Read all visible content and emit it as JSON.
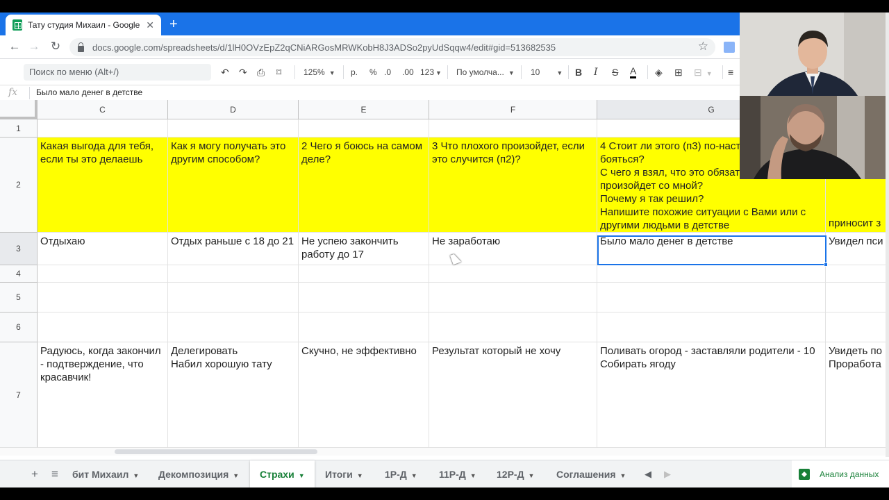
{
  "browser": {
    "tab_title": "Тату студия Михаил - Google Таблицы",
    "url": "docs.google.com/spreadsheets/d/1lH0OVzEpZ2qCNiARGosMRWKobH8J3ADSo2pyUdSqqw4/edit#gid=513682535"
  },
  "toolbar": {
    "menu_search": "Поиск по меню (Alt+/)",
    "zoom": "125%",
    "currency": "р.",
    "percent": "%",
    "dec_decrease": ".0",
    "dec_increase": ".00",
    "format_more": "123",
    "font": "По умолча...",
    "font_size": "10",
    "bold": "B",
    "italic": "I",
    "strike": "S",
    "text_color": "A"
  },
  "formula_bar": {
    "fx": "fx",
    "value": "Было мало денег в детстве"
  },
  "columns": [
    "C",
    "D",
    "E",
    "F",
    "G"
  ],
  "rows": {
    "r1": "1",
    "r2": "2",
    "r3": "3",
    "r4": "4",
    "r5": "5",
    "r6": "6",
    "r7": "7"
  },
  "cells": {
    "r2": {
      "c": "Какая выгода для тебя, если ты это делаешь",
      "d": "Как я могу получать это другим способом?",
      "e": "2 Чего я боюсь на самом деле?",
      "f": "3 Что плохого произойдет, если это случится (п2)?",
      "g": "4 Стоит ли этого (п3) по-настоящему бояться?\nС чего я взял, что это обязательно произойдет со мной?\nПочему я так решил?\nНапишите похожие ситуации с Вами или с другими людьми в детстве",
      "h": "приносит з"
    },
    "r3": {
      "c": "Отдыхаю",
      "d": "Отдых раньше с 18 до 21",
      "e": "Не успею закончить работу до 17",
      "f": "Не заработаю",
      "g": "Было мало денег в детстве",
      "h": "Увидел пси"
    },
    "r7": {
      "c": "Радуюсь, когда закончил - подтверждение, что красавчик!",
      "d": "Делегировать\nНабил хорошую тату",
      "e": "Скучно, не эффективно",
      "f": "Результат который не хочу",
      "g": "Поливать огород - заставляли родители - 10\nСобирать ягоду",
      "h": "Увидеть по\nПроработа"
    }
  },
  "sheets": {
    "tabs": [
      "бит Михаил",
      "Декомпозиция",
      "Страхи",
      "Итоги",
      "1Р-Д",
      "11Р-Д",
      "12Р-Д",
      "Соглашения"
    ],
    "active": "Страхи",
    "explore": "Анализ данных"
  }
}
